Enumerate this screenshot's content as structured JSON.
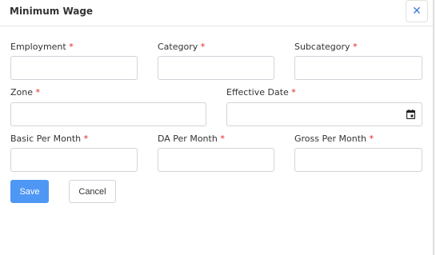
{
  "modal": {
    "title": "Minimum Wage",
    "close_icon": "close-icon"
  },
  "fields": {
    "employment": {
      "label": "Employment",
      "required": "*",
      "value": ""
    },
    "category": {
      "label": "Category",
      "required": "*",
      "value": ""
    },
    "subcategory": {
      "label": "Subcategory",
      "required": "*",
      "value": ""
    },
    "zone": {
      "label": "Zone",
      "required": "*",
      "value": ""
    },
    "effective_date": {
      "label": "Effective Date",
      "required": "*",
      "value": "",
      "icon": "calendar-icon"
    },
    "basic_per_month": {
      "label": "Basic Per Month",
      "required": "*",
      "value": ""
    },
    "da_per_month": {
      "label": "DA Per Month",
      "required": "*",
      "value": ""
    },
    "gross_per_month": {
      "label": "Gross Per Month",
      "required": "*",
      "value": ""
    }
  },
  "actions": {
    "save_label": "Save",
    "cancel_label": "Cancel"
  },
  "colors": {
    "primary": "#4f97f4",
    "required": "#e02424",
    "close": "#3d7bd9"
  }
}
